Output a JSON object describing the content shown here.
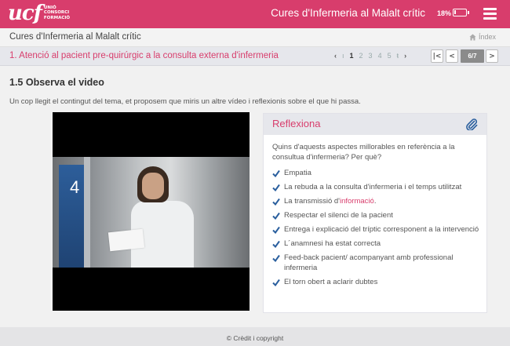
{
  "header": {
    "logo_mark": "ucf",
    "logo_lines": [
      "UNIÓ",
      "CONSORCI",
      "FORMACIÓ"
    ],
    "app_title": "Cures d'Infermeria al Malalt crític",
    "battery_pct": "18%",
    "battery_level": 0.18,
    "icons": [
      "battery-icon",
      "menu-icon"
    ]
  },
  "course": {
    "title": "Cures d'Infermeria al Malalt crític",
    "index_label": "Índex"
  },
  "unit": {
    "title": "1. Atenció al pacient pre-quirúrgic a la consulta externa d'infermeria",
    "pager": {
      "prev": "‹",
      "first": "ı",
      "pages": [
        "1",
        "2",
        "3",
        "4",
        "5"
      ],
      "active_page": "1",
      "last": "ŧ",
      "next": "›"
    },
    "page_count": "6/7",
    "nav_first": "|<",
    "nav_prev": "<",
    "nav_next": ">"
  },
  "main": {
    "section_title": "1.5 Observa el video",
    "intro": "Un cop llegit el contingut del tema, et proposem que miris un altre vídeo i reflexionis sobre el que hi passa.",
    "video_door_number": "4"
  },
  "reflexiona": {
    "title": "Reflexiona",
    "question": "Quins d'aquests aspectes millorables en referència a la consultua d'infermeria? Per què?",
    "items": [
      "Empatia",
      "La rebuda a la consulta d'infermeria i el temps utilitzat",
      "La transmissió d'",
      "Respectar el silenci de la pacient",
      "Entrega i explicació del tríptic corresponent a la intervenció",
      "L´anamnesi ha estat correcta",
      "Feed-back pacient/ acompanyant amb professional infermeria",
      "El torn obert a aclarir dubtes"
    ],
    "highlight_word": "informació",
    "highlight_tail": "."
  },
  "footer": {
    "credit": "© Crèdit i copyright"
  },
  "colors": {
    "brand": "#d83d6c",
    "bar_grey": "#e6e7ec",
    "check_blue": "#2a5f9e"
  }
}
